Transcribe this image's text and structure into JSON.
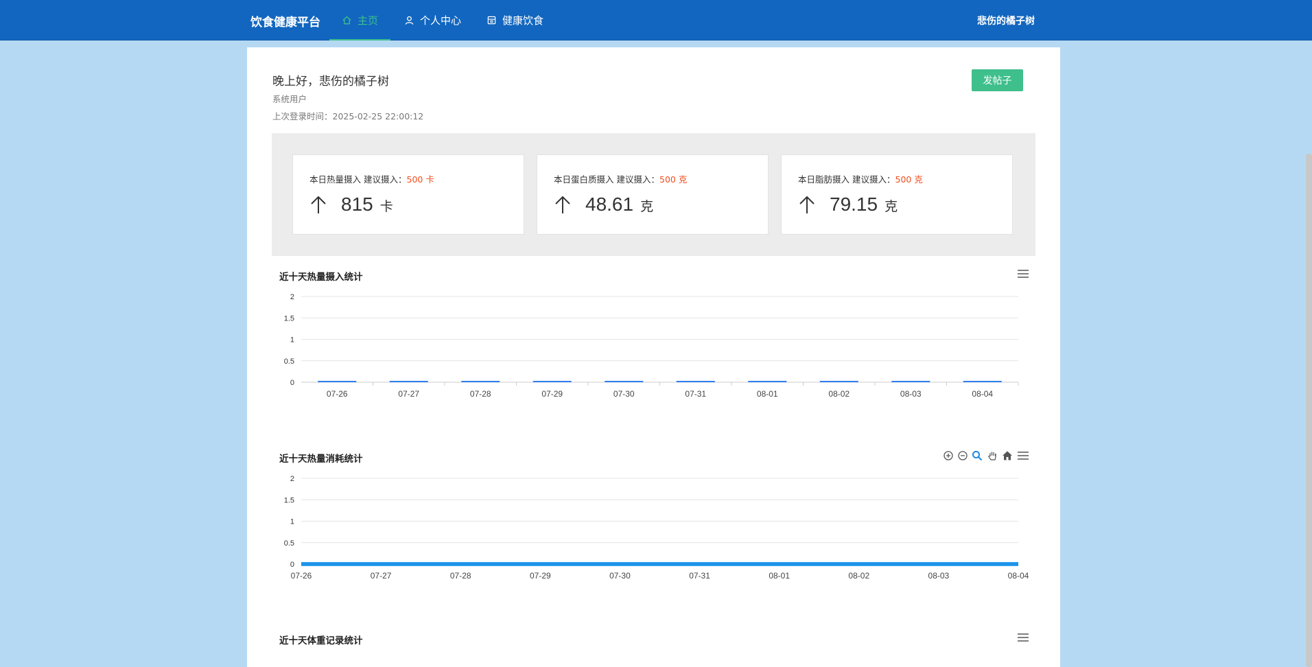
{
  "header": {
    "brand": "饮食健康平台",
    "nav": [
      {
        "label": "主页",
        "icon": "home-icon",
        "active": true
      },
      {
        "label": "个人中心",
        "icon": "user-icon",
        "active": false
      },
      {
        "label": "健康饮食",
        "icon": "food-icon",
        "active": false
      }
    ],
    "username": "悲伤的橘子树"
  },
  "profile": {
    "greeting": "晚上好，悲伤的橘子树",
    "role": "系统用户",
    "last_login": "上次登录时间：2025-02-25 22:00:12",
    "post_button": "发帖子"
  },
  "stats": [
    {
      "title": "本日热量摄入",
      "rec_label": "建议摄入：",
      "rec_value": "500 卡",
      "value": "815",
      "unit": "卡"
    },
    {
      "title": "本日蛋白质摄入",
      "rec_label": "建议摄入：",
      "rec_value": "500 克",
      "value": "48.61",
      "unit": "克"
    },
    {
      "title": "本日脂肪摄入",
      "rec_label": "建议摄入：",
      "rec_value": "500 克",
      "value": "79.15",
      "unit": "克"
    }
  ],
  "colors": {
    "nav_bg": "#1266bf",
    "accent_green": "#3fbf8c",
    "warning_red": "#f24e1e",
    "series_blue": "#2f80ed"
  },
  "chart_data": [
    {
      "type": "bar",
      "title": "近十天热量摄入统计",
      "categories": [
        "07-26",
        "07-27",
        "07-28",
        "07-29",
        "07-30",
        "07-31",
        "08-01",
        "08-02",
        "08-03",
        "08-04"
      ],
      "values": [
        0,
        0,
        0,
        0,
        0,
        0,
        0,
        0,
        0,
        0
      ],
      "yticks": [
        "0",
        "0.5",
        "1",
        "1.5",
        "2"
      ],
      "ylim": [
        0,
        2
      ],
      "grid": true
    },
    {
      "type": "area",
      "title": "近十天热量消耗统计",
      "categories": [
        "07-26",
        "07-27",
        "07-28",
        "07-29",
        "07-30",
        "07-31",
        "08-01",
        "08-02",
        "08-03",
        "08-04"
      ],
      "values": [
        0,
        0,
        0,
        0,
        0,
        0,
        0,
        0,
        0,
        0
      ],
      "yticks": [
        "0",
        "0.5",
        "1",
        "1.5",
        "2"
      ],
      "ylim": [
        0,
        2
      ],
      "grid": true,
      "toolbox": [
        "zoom-in-icon",
        "zoom-out-icon",
        "magnify-icon",
        "pan-hand-icon",
        "reset-home-icon",
        "menu-icon"
      ]
    },
    {
      "type": "line",
      "title": "近十天体重记录统计",
      "categories": [],
      "values": []
    }
  ]
}
